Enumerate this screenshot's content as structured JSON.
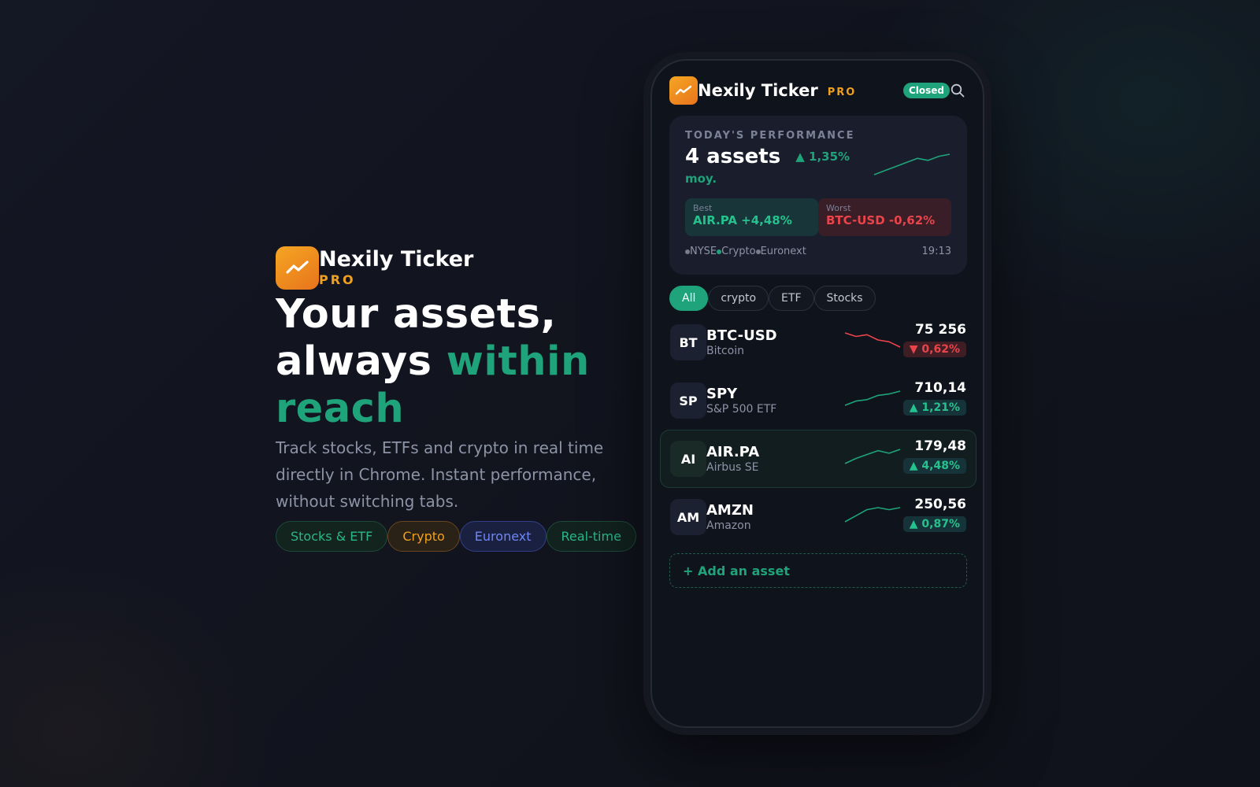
{
  "hero": {
    "brand_name": "Nexily Ticker",
    "brand_pro": "PRO",
    "headline_1": "Your assets,",
    "headline_2": "always ",
    "headline_accent": "within reach",
    "subtitle": "Track stocks, ETFs and crypto in real time directly in Chrome. Instant performance, without switching tabs.",
    "tags": [
      "Stocks & ETF",
      "Crypto",
      "Euronext",
      "Real-time"
    ]
  },
  "app": {
    "title": "Nexily Ticker",
    "pro": "PRO",
    "status": "Closed",
    "icons": {
      "logo": "trend-chart-icon",
      "search": "search-icon"
    }
  },
  "performance": {
    "label": "TODAY'S PERFORMANCE",
    "assets": "4 assets",
    "change": "▲ 1,35%",
    "moy": "moy.",
    "best_label": "Best",
    "best_value": "AIR.PA +4,48%",
    "worst_label": "Worst",
    "worst_value": "BTC-USD -0,62%",
    "markets": [
      "NYSE",
      "Crypto",
      "Euronext"
    ],
    "time": "19:13",
    "spark": [
      2,
      4,
      6,
      8,
      10,
      9,
      11,
      12
    ]
  },
  "filters": [
    "All",
    "crypto",
    "ETF",
    "Stocks"
  ],
  "assets": [
    {
      "abbr": "BT",
      "symbol": "BTC-USD",
      "name": "Bitcoin",
      "price": "75 256",
      "change": "▼ 0,62%",
      "trend": "down",
      "spark": [
        12,
        10,
        11,
        8,
        7,
        4
      ]
    },
    {
      "abbr": "SP",
      "symbol": "SPY",
      "name": "S&P 500 ETF",
      "price": "710,14",
      "change": "▲ 1,21%",
      "trend": "up",
      "spark": [
        2,
        5,
        6,
        9,
        10,
        12
      ]
    },
    {
      "abbr": "AI",
      "symbol": "AIR.PA",
      "name": "Airbus SE",
      "price": "179,48",
      "change": "▲ 4,48%",
      "trend": "up",
      "spark": [
        1,
        5,
        8,
        11,
        9,
        12
      ]
    },
    {
      "abbr": "AM",
      "symbol": "AMZN",
      "name": "Amazon",
      "price": "250,56",
      "change": "▲ 0,87%",
      "trend": "up",
      "spark": [
        2,
        5,
        8,
        9,
        8,
        9
      ]
    }
  ],
  "add_asset": "+ Add an asset",
  "colors": {
    "accent": "#1fa37a",
    "brand": "#f0a020",
    "down": "#e8444a",
    "up": "#25c28d"
  }
}
